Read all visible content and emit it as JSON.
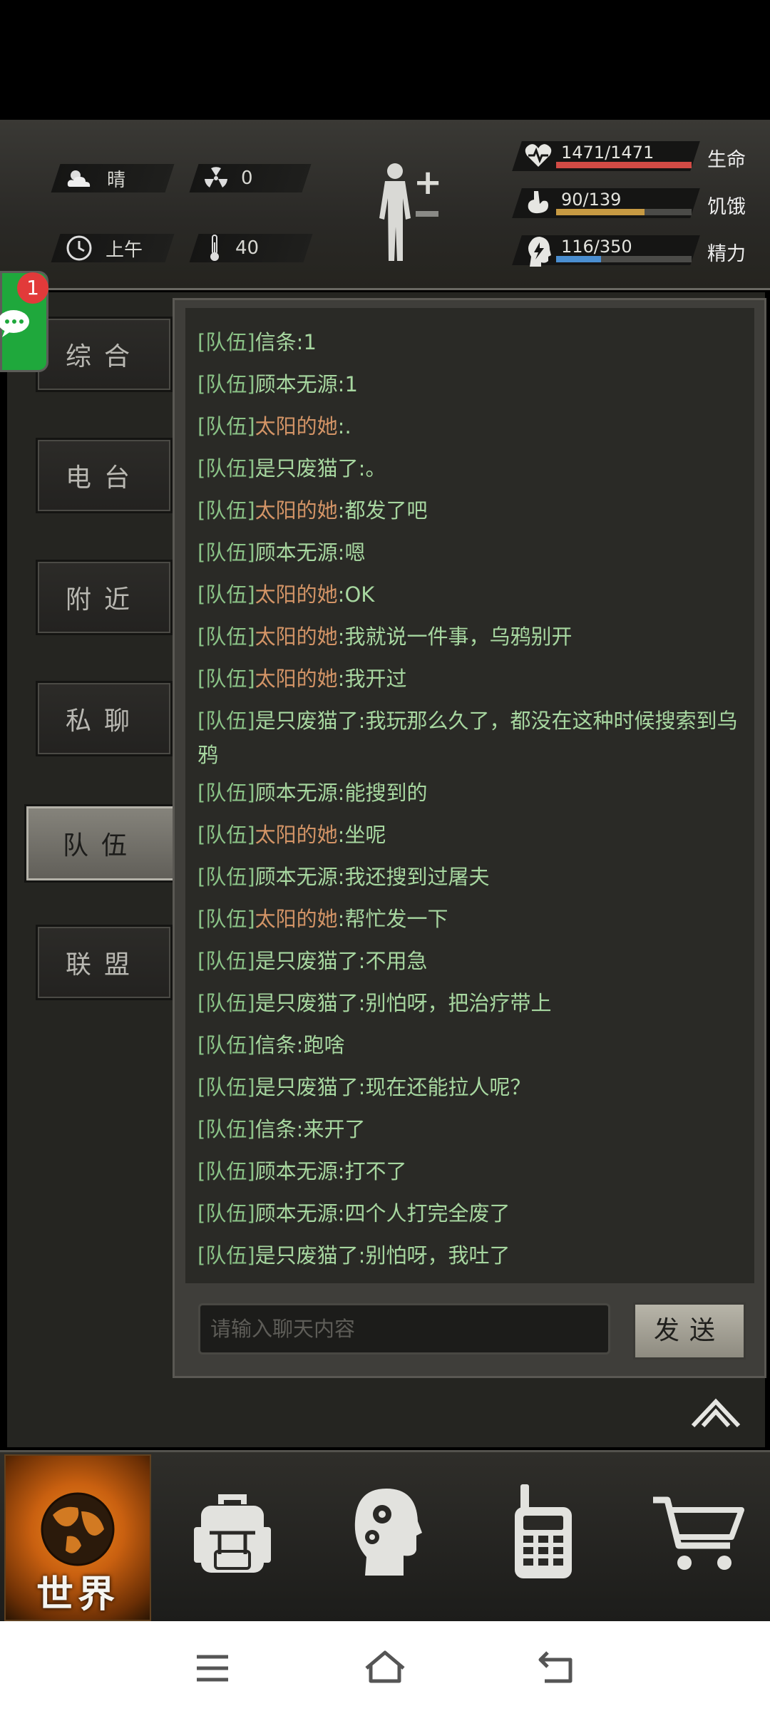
{
  "status": {
    "weather": "晴",
    "radiation": "0",
    "time_of_day": "上午",
    "temperature": "40",
    "life": {
      "text": "1471/1471",
      "label": "生命",
      "fraction": 1.0,
      "color": "#d24b45"
    },
    "hunger": {
      "text": "90/139",
      "label": "饥饿",
      "fraction": 0.65,
      "color": "#c79a43"
    },
    "energy": {
      "text": "116/350",
      "label": "精力",
      "fraction": 0.33,
      "color": "#4a8ed0"
    }
  },
  "notification_badge": "1",
  "tabs": [
    {
      "label": "综合",
      "active": false
    },
    {
      "label": "电台",
      "active": false
    },
    {
      "label": "附近",
      "active": false
    },
    {
      "label": "私聊",
      "active": false
    },
    {
      "label": "队伍",
      "active": true
    },
    {
      "label": "联盟",
      "active": false
    }
  ],
  "messages": [
    {
      "channel": "[队伍]",
      "sender": "信条",
      "sep": ":",
      "text": "1",
      "sender_color": "green"
    },
    {
      "channel": "[队伍]",
      "sender": "顾本无源",
      "sep": ":",
      "text": "1",
      "sender_color": "green"
    },
    {
      "channel": "[队伍]",
      "sender": "太阳的她",
      "sep": ":",
      "text": ".",
      "sender_color": "orange"
    },
    {
      "channel": "[队伍]",
      "sender": "是只废猫了",
      "sep": ":",
      "text": "。",
      "sender_color": "green"
    },
    {
      "channel": "[队伍]",
      "sender": "太阳的她",
      "sep": ":",
      "text": "都发了吧",
      "sender_color": "orange"
    },
    {
      "channel": "[队伍]",
      "sender": "顾本无源",
      "sep": ":",
      "text": "嗯",
      "sender_color": "green"
    },
    {
      "channel": "[队伍]",
      "sender": "太阳的她",
      "sep": ":",
      "text": "OK",
      "sender_color": "orange"
    },
    {
      "channel": "[队伍]",
      "sender": "太阳的她",
      "sep": ":",
      "text": "我就说一件事，乌鸦别开",
      "sender_color": "orange"
    },
    {
      "channel": "[队伍]",
      "sender": "太阳的她",
      "sep": ":",
      "text": "我开过",
      "sender_color": "orange"
    },
    {
      "channel": "[队伍]",
      "sender": "是只废猫了",
      "sep": ":",
      "text": "我玩那么久了，都没在这种时候搜索到乌鸦",
      "sender_color": "green"
    },
    {
      "channel": "[队伍]",
      "sender": "顾本无源",
      "sep": ":",
      "text": "能搜到的",
      "sender_color": "green"
    },
    {
      "channel": "[队伍]",
      "sender": "太阳的她",
      "sep": ":",
      "text": "坐呢",
      "sender_color": "orange"
    },
    {
      "channel": "[队伍]",
      "sender": "顾本无源",
      "sep": ":",
      "text": "我还搜到过屠夫",
      "sender_color": "green"
    },
    {
      "channel": "[队伍]",
      "sender": "太阳的她",
      "sep": ":",
      "text": "帮忙发一下",
      "sender_color": "orange"
    },
    {
      "channel": "[队伍]",
      "sender": "是只废猫了",
      "sep": ":",
      "text": "不用急",
      "sender_color": "green"
    },
    {
      "channel": "[队伍]",
      "sender": "是只废猫了",
      "sep": ":",
      "text": "别怕呀，把治疗带上",
      "sender_color": "green"
    },
    {
      "channel": "[队伍]",
      "sender": "信条",
      "sep": ":",
      "text": "跑啥",
      "sender_color": "green"
    },
    {
      "channel": "[队伍]",
      "sender": "是只废猫了",
      "sep": ":",
      "text": "现在还能拉人呢？",
      "sender_color": "green"
    },
    {
      "channel": "[队伍]",
      "sender": "信条",
      "sep": ":",
      "text": "来开了",
      "sender_color": "green"
    },
    {
      "channel": "[队伍]",
      "sender": "顾本无源",
      "sep": ":",
      "text": "打不了",
      "sender_color": "green"
    },
    {
      "channel": "[队伍]",
      "sender": "顾本无源",
      "sep": ":",
      "text": "四个人打完全废了",
      "sender_color": "green"
    },
    {
      "channel": "[队伍]",
      "sender": "是只废猫了",
      "sep": ":",
      "text": "别怕呀，我吐了",
      "sender_color": "green"
    }
  ],
  "chat_input": {
    "placeholder": "请输入聊天内容",
    "value": ""
  },
  "send_label": "发送",
  "bottom_nav": {
    "world_label": "世界"
  }
}
